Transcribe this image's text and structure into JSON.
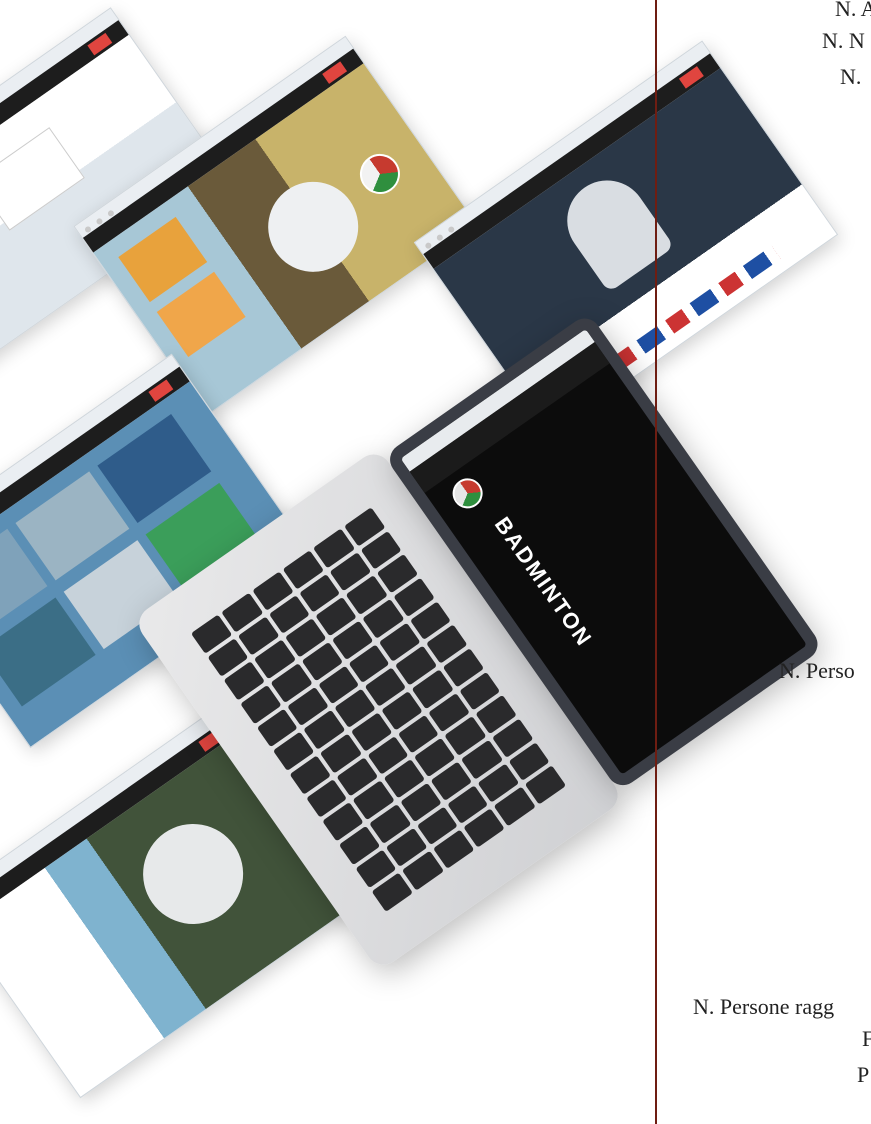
{
  "right_column": {
    "line1": "N. A",
    "line2": "N. N",
    "line3": "N.",
    "line4": "N. Perso",
    "line5": "N. Persone ragg",
    "line6": "F",
    "line7": "P"
  },
  "laptop": {
    "brand_text": "BADMINTON"
  },
  "colors": {
    "divider": "#6e1d12",
    "accent_red": "#e0453f",
    "panel_blue": "#5b8fb5",
    "site_dark": "#1d1d1d"
  },
  "icons": {
    "federation_logo": "badminton-federation-logo",
    "shuttlecock": "shuttlecock-image"
  }
}
